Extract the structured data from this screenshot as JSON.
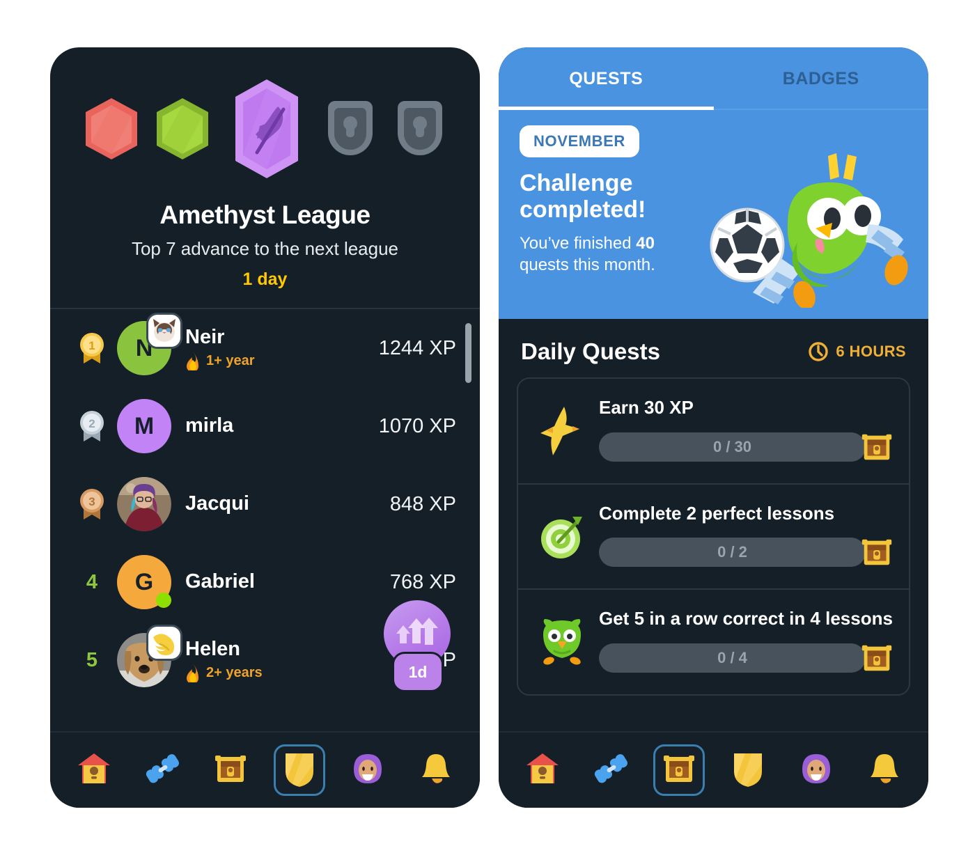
{
  "left_panel": {
    "league": {
      "title": "Amethyst League",
      "subtitle": "Top 7 advance to the next league",
      "timer": "1 day",
      "gems": [
        {
          "name": "ruby-league-gem",
          "state": "past",
          "color": "#e8645c"
        },
        {
          "name": "emerald-league-gem",
          "state": "past",
          "color": "#9fd337"
        },
        {
          "name": "amethyst-league-gem",
          "state": "current",
          "color": "#c07ff0"
        },
        {
          "name": "locked-league-gem-1",
          "state": "locked",
          "color": "#6b7784"
        },
        {
          "name": "locked-league-gem-2",
          "state": "locked",
          "color": "#6b7784"
        }
      ]
    },
    "leaderboard": [
      {
        "rank": "1",
        "rank_type": "medal-gold",
        "name": "Neir",
        "xp": "1244 XP",
        "streak": "1+ year",
        "avatar_type": "initial",
        "avatar_initial": "N",
        "avatar_color": "#8ac43f",
        "badge": "cat-face-badge",
        "online": false
      },
      {
        "rank": "2",
        "rank_type": "medal-silver",
        "name": "mirla",
        "xp": "1070 XP",
        "streak": "",
        "avatar_type": "initial",
        "avatar_initial": "M",
        "avatar_color": "#c183f5",
        "badge": "",
        "online": false
      },
      {
        "rank": "3",
        "rank_type": "medal-bronze",
        "name": "Jacqui",
        "xp": "848 XP",
        "streak": "",
        "avatar_type": "photo-person",
        "avatar_initial": "",
        "avatar_color": "#8d6a5c",
        "badge": "",
        "online": false
      },
      {
        "rank": "4",
        "rank_type": "number",
        "name": "Gabriel",
        "xp": "768 XP",
        "streak": "",
        "avatar_type": "initial",
        "avatar_initial": "G",
        "avatar_color": "#f5a93c",
        "badge": "",
        "online": true
      },
      {
        "rank": "5",
        "rank_type": "number",
        "name": "Helen",
        "xp": "XP",
        "streak": "2+ years",
        "avatar_type": "photo-dog",
        "avatar_initial": "",
        "avatar_color": "#b69478",
        "badge": "flexed-arm-badge",
        "online": false
      }
    ],
    "boost_badge": {
      "label": "1d",
      "icon": "xp-boost-arrows-icon",
      "color": "#b57ae8"
    },
    "nav": [
      {
        "name": "nav-home",
        "icon": "birdhouse-icon",
        "active": false
      },
      {
        "name": "nav-practice",
        "icon": "dumbbell-icon",
        "active": false
      },
      {
        "name": "nav-quests",
        "icon": "treasure-chest-icon",
        "active": false
      },
      {
        "name": "nav-leaderboard",
        "icon": "shield-icon",
        "active": true
      },
      {
        "name": "nav-profile",
        "icon": "avatar-person-icon",
        "active": false
      },
      {
        "name": "nav-notifications",
        "icon": "bell-icon",
        "active": false
      }
    ]
  },
  "right_panel": {
    "tabs": [
      {
        "label": "QUESTS",
        "active": true
      },
      {
        "label": "BADGES",
        "active": false
      }
    ],
    "challenge": {
      "month_pill": "NOVEMBER",
      "title": "Challenge completed!",
      "sub_prefix": "You’ve finished ",
      "sub_count": "40",
      "sub_suffix": " quests this month.",
      "mascot": "duo-owl-soccer-icon",
      "bg_color": "#4a93e0"
    },
    "daily_quests": {
      "title": "Daily Quests",
      "timer": "6 HOURS",
      "timer_icon": "clock-icon",
      "items": [
        {
          "name": "Earn 30 XP",
          "icon": "lightning-bolt-icon",
          "progress_label": "0 / 30",
          "progress_pct": 0,
          "chest": "treasure-chest-icon"
        },
        {
          "name": "Complete 2 perfect lessons",
          "icon": "target-bullseye-icon",
          "progress_label": "0 / 2",
          "progress_pct": 0,
          "chest": "treasure-chest-icon"
        },
        {
          "name": "Get 5 in a row correct in 4 lessons",
          "icon": "duo-owl-icon",
          "progress_label": "0 / 4",
          "progress_pct": 0,
          "chest": "treasure-chest-icon"
        }
      ]
    },
    "nav": [
      {
        "name": "nav-home",
        "icon": "birdhouse-icon",
        "active": false
      },
      {
        "name": "nav-practice",
        "icon": "dumbbell-icon",
        "active": false
      },
      {
        "name": "nav-quests",
        "icon": "treasure-chest-icon",
        "active": true
      },
      {
        "name": "nav-leaderboard",
        "icon": "shield-icon",
        "active": false
      },
      {
        "name": "nav-profile",
        "icon": "avatar-person-icon",
        "active": false
      },
      {
        "name": "nav-notifications",
        "icon": "bell-icon",
        "active": false
      }
    ]
  }
}
